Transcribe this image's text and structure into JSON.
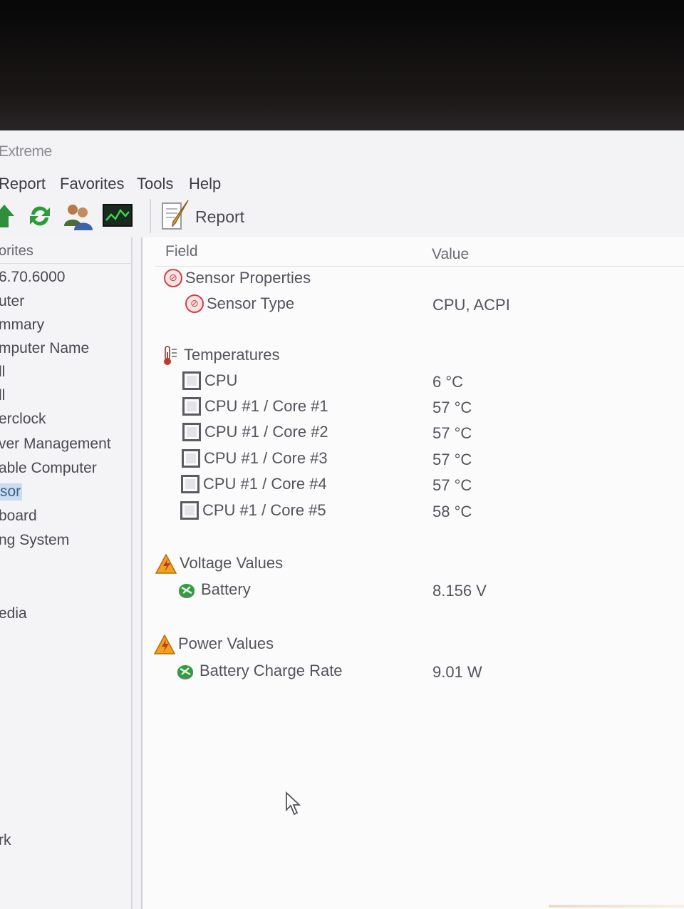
{
  "window": {
    "title": "Extreme"
  },
  "menu": [
    "Report",
    "Favorites",
    "Tools",
    "Help"
  ],
  "toolbar": {
    "icons": [
      "up-arrow-icon",
      "refresh-icon",
      "users-icon",
      "monitor-icon"
    ],
    "report_label": "Report"
  },
  "sidebar": {
    "header": "orites",
    "items": [
      {
        "label": "6.70.6000",
        "selected": false
      },
      {
        "label": "uter",
        "selected": false
      },
      {
        "label": "mmary",
        "selected": false
      },
      {
        "label": "mputer Name",
        "selected": false
      },
      {
        "label": "ll",
        "selected": false
      },
      {
        "label": "ll",
        "selected": false
      },
      {
        "label": "erclock",
        "selected": false
      },
      {
        "label": "ver Management",
        "selected": false
      },
      {
        "label": "able Computer",
        "selected": false
      },
      {
        "label": "sor",
        "selected": true
      },
      {
        "label": "board",
        "selected": false
      },
      {
        "label": "ng System",
        "selected": false
      },
      {
        "label": "edia",
        "selected": false
      },
      {
        "label": "rk",
        "selected": false
      }
    ]
  },
  "table": {
    "columns": {
      "field": "Field",
      "value": "Value"
    },
    "groups": [
      {
        "name": "Sensor Properties",
        "icon": "sensor-icon",
        "rows": [
          {
            "field": "Sensor Type",
            "value": "CPU, ACPI",
            "icon": "sensor-icon"
          }
        ]
      },
      {
        "name": "Temperatures",
        "icon": "thermometer-icon",
        "rows": [
          {
            "field": "CPU",
            "value": "6 °C",
            "icon": "chip-icon"
          },
          {
            "field": "CPU #1 / Core #1",
            "value": "57 °C",
            "icon": "chip-icon"
          },
          {
            "field": "CPU #1 / Core #2",
            "value": "57 °C",
            "icon": "chip-icon"
          },
          {
            "field": "CPU #1 / Core #3",
            "value": "57 °C",
            "icon": "chip-icon"
          },
          {
            "field": "CPU #1 / Core #4",
            "value": "57 °C",
            "icon": "chip-icon"
          },
          {
            "field": "CPU #1 / Core #5",
            "value": "58 °C",
            "icon": "chip-icon"
          }
        ]
      },
      {
        "name": "Voltage Values",
        "icon": "warning-icon",
        "rows": [
          {
            "field": "Battery",
            "value": "8.156 V",
            "icon": "battery-icon"
          }
        ]
      },
      {
        "name": "Power Values",
        "icon": "warning-icon",
        "rows": [
          {
            "field": "Battery Charge Rate",
            "value": "9.01 W",
            "icon": "battery-icon"
          }
        ]
      }
    ]
  }
}
